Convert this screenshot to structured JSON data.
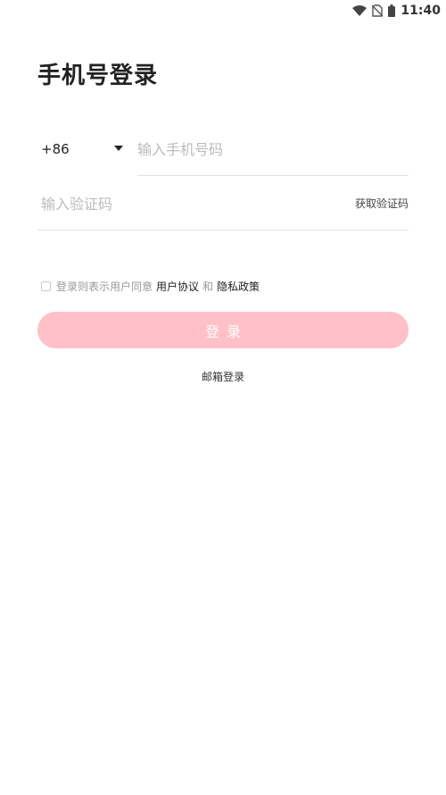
{
  "status_bar": {
    "time": "11:40",
    "icons": [
      "wifi-icon",
      "no-sim-icon",
      "battery-icon"
    ]
  },
  "title": "手机号登录",
  "phone": {
    "country_code": "+86",
    "placeholder": "输入手机号码",
    "value": ""
  },
  "code": {
    "placeholder": "输入验证码",
    "value": "",
    "get_code_label": "获取验证码"
  },
  "agreement": {
    "prefix": "登录则表示用户同意",
    "user_agreement": "用户协议",
    "connector": "和",
    "privacy_policy": "隐私政策",
    "checked": false
  },
  "login_button": {
    "label": "登录"
  },
  "email_login_label": "邮箱登录",
  "colors": {
    "button_bg": "#ffc0c7",
    "text_dark": "#222222",
    "placeholder": "#bbbbbb",
    "divider": "#e2e2e2"
  }
}
